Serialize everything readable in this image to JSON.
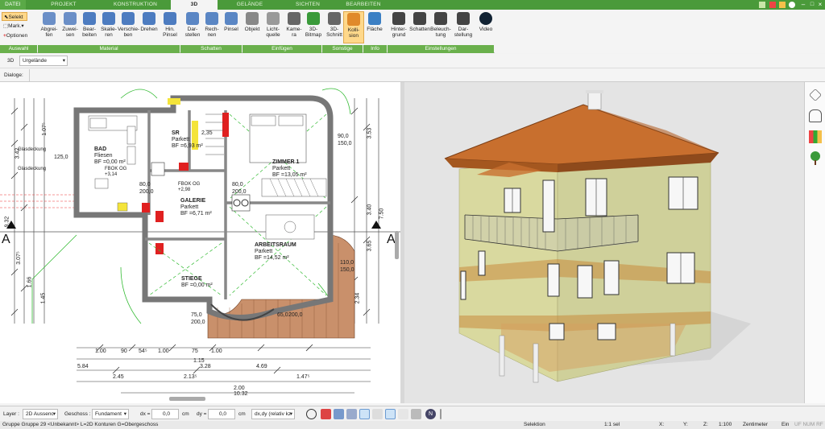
{
  "tabs": [
    "DATEI",
    "PROJEKT",
    "KONSTRUKTION",
    "3D",
    "GELÄNDE",
    "SICHTEN",
    "BEARBEITEN"
  ],
  "left_small": {
    "select": "Selekt",
    "mark": "Mark.",
    "options": "Optionen",
    "group": "Auswahl"
  },
  "ribbon_buttons": [
    {
      "label": "Abgrei-\nfen",
      "icon": "eyedropper-icon"
    },
    {
      "label": "Zuwei-\nsen",
      "icon": "assign-icon"
    },
    {
      "label": "Bear-\nbeiten",
      "icon": "edit-material-icon"
    },
    {
      "label": "Skalie-\nren",
      "icon": "scale-icon"
    },
    {
      "label": "Verschie-\nben",
      "icon": "move-icon"
    },
    {
      "label": "Drehen",
      "icon": "rotate-icon"
    },
    {
      "label": "Hin.\nPinsel",
      "icon": "brush-icon"
    },
    {
      "label": "Dar-\nstellen",
      "icon": "shading-icon"
    },
    {
      "label": "Rech-\nnen",
      "icon": "compute-icon"
    },
    {
      "label": "Pinsel",
      "icon": "paintbrush-icon"
    },
    {
      "label": "Objekt",
      "icon": "chair-icon"
    },
    {
      "label": "Licht-\nquelle",
      "icon": "bulb-icon"
    },
    {
      "label": "Kame-\nra",
      "icon": "camera-icon"
    },
    {
      "label": "3D-\nBitmap",
      "icon": "tree-icon"
    },
    {
      "label": "3D-\nSchnitt",
      "icon": "section-icon"
    },
    {
      "label": "Kolli-\nsion",
      "icon": "collision-icon"
    },
    {
      "label": "Fläche",
      "icon": "area-icon"
    },
    {
      "label": "Hinter-\ngrund",
      "icon": "background-icon"
    },
    {
      "label": "Schatten",
      "icon": "shadow-icon"
    },
    {
      "label": "Beleuch-\ntung",
      "icon": "lighting-icon"
    },
    {
      "label": "Dar-\nstellung",
      "icon": "display-icon"
    },
    {
      "label": "Video",
      "icon": "video-icon"
    }
  ],
  "ribbon_groups": [
    "Material",
    "Schatten",
    "Einfügen",
    "Sonstige",
    "Info",
    "Einstellungen"
  ],
  "view_mode": {
    "label": "3D",
    "value": "Urgelände"
  },
  "dialog_label": "Dialoge:",
  "plan": {
    "rooms": [
      {
        "name": "BAD",
        "floor": "Fliesen",
        "area": "BF =0,00 m²"
      },
      {
        "name": "SR",
        "floor": "Parkett",
        "area": "BF =6,93 m²"
      },
      {
        "name": "ZIMMER 1",
        "floor": "Parkett",
        "area": "BF =13,05 m²"
      },
      {
        "name": "GALERIE",
        "floor": "Parkett",
        "area": "BF =6,71 m²"
      },
      {
        "name": "ARBEITSRAUM",
        "floor": "Parkett",
        "area": "BF =14,52 m²"
      },
      {
        "name": "STIEGE",
        "floor": "",
        "area": "BF =0,00 m²"
      }
    ],
    "dims_bottom": [
      "1.00",
      "90",
      "54⁵",
      "1.00",
      "75",
      "1.00",
      "1.15",
      "3.28",
      "4.69",
      "5.84",
      "2.45",
      "2.13⁵",
      "1.47⁵",
      "2.00",
      "10.32"
    ],
    "dims_left": [
      "3.42",
      "1.07⁵",
      "3.07⁵",
      "1.66",
      "1.45",
      "9.32"
    ],
    "dims_right": [
      "3.53",
      "3.40",
      "3.65",
      "2.34",
      "7.50"
    ],
    "misc_labels": [
      "Glasdeckung",
      "Glasdeckung",
      "FBOK OG",
      "+3,14",
      "FBOK OG",
      "+2,98",
      "80,0",
      "200,0",
      "80,0",
      "200,0",
      "110,0",
      "150,0",
      "90,0",
      "150,0",
      "2,35",
      "65,0",
      "200,0",
      "75,0",
      "200,0",
      "125,0",
      "A",
      "A"
    ]
  },
  "bottom_toolbar": {
    "layer_label": "Layer :",
    "layer_value": "2D Aussenc",
    "floor_label": "Geschoss :",
    "floor_value": "Fundament",
    "dx_label": "dx =",
    "dx_value": "0,0",
    "dx_unit": "cm",
    "dy_label": "dy =",
    "dy_value": "0,0",
    "dy_unit": "cm",
    "mode_value": "dx,dy (relativ kz"
  },
  "status": {
    "left": "Gruppe Gruppe 29 <Unbekannt> L=2D Konturen G=Obergeschoss",
    "mode": "Selektion",
    "selection": "1:1 sel",
    "x": "X:",
    "y": "Y:",
    "z": "Z:",
    "scale": "1:100",
    "unit": "Zentimeter",
    "toggle": "Ein",
    "tail": "UF NUM RF"
  },
  "colors": {
    "accent": "#4a9a3a",
    "ribbon_group": "#6ab04c",
    "wall": "#8a8a8a",
    "roof": "#c86f2e",
    "facade": "#d6d69a"
  }
}
